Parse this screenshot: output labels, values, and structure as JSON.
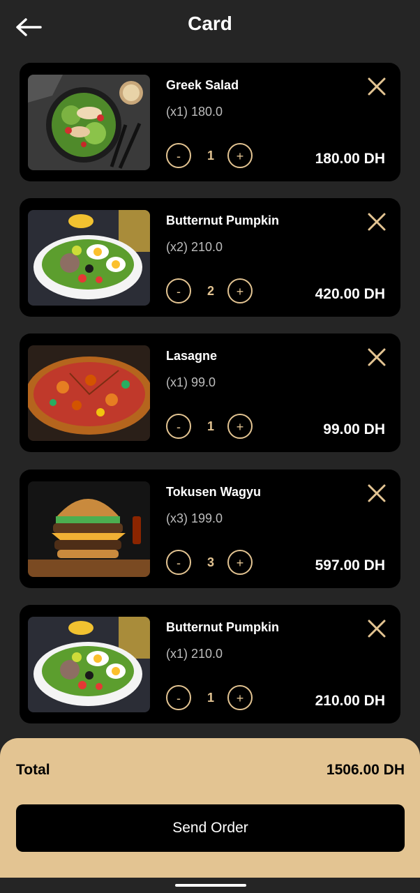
{
  "header": {
    "title": "Card",
    "back_icon": "arrow-left-icon"
  },
  "items": [
    {
      "name": "Greek Salad",
      "unit": "(x1) 180.0",
      "qty": "1",
      "line_total": "180.00 DH",
      "image": "greek-salad"
    },
    {
      "name": "Butternut Pumpkin",
      "unit": "(x2) 210.0",
      "qty": "2",
      "line_total": "420.00 DH",
      "image": "egg-salad"
    },
    {
      "name": "Lasagne",
      "unit": "(x1) 99.0",
      "qty": "1",
      "line_total": "99.00 DH",
      "image": "pizza"
    },
    {
      "name": "Tokusen Wagyu",
      "unit": "(x3) 199.0",
      "qty": "3",
      "line_total": "597.00 DH",
      "image": "burger"
    },
    {
      "name": "Butternut Pumpkin",
      "unit": "(x1) 210.0",
      "qty": "1",
      "line_total": "210.00 DH",
      "image": "egg-salad"
    }
  ],
  "controls": {
    "minus": "-",
    "plus": "+"
  },
  "footer": {
    "total_label": "Total",
    "total_value": "1506.00 DH",
    "send_label": "Send Order"
  },
  "colors": {
    "accent": "#e3c492",
    "background": "#252525",
    "card": "#000000"
  }
}
